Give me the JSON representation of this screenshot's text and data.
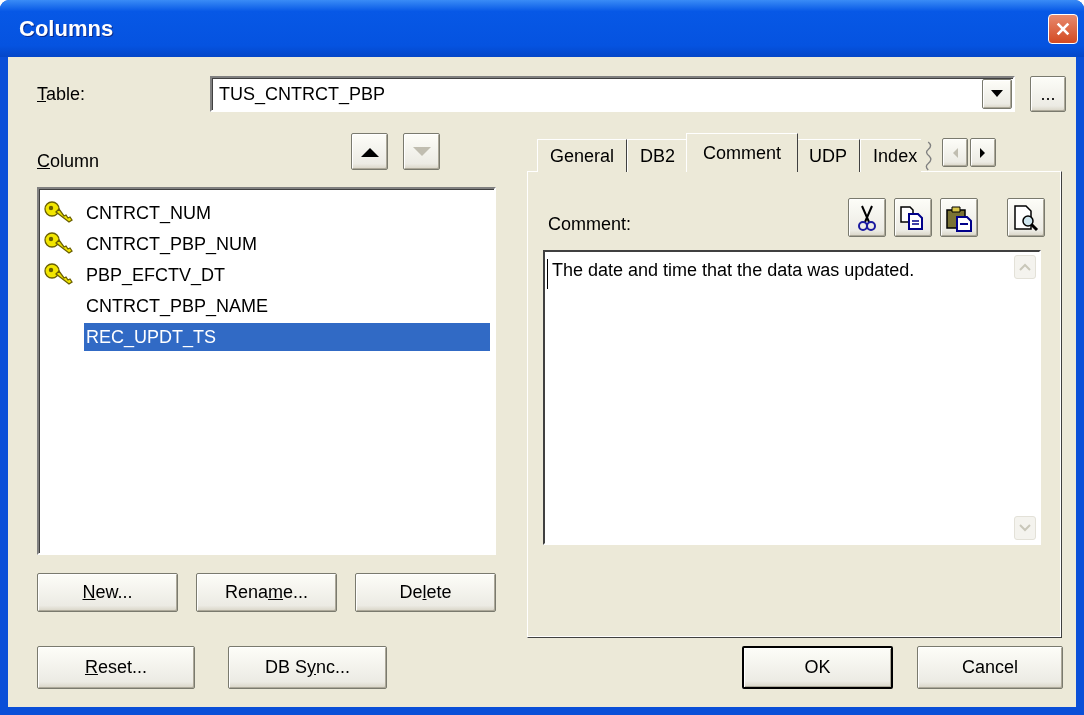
{
  "window": {
    "title": "Columns"
  },
  "table_field": {
    "label": {
      "key": "T",
      "post": "able:"
    },
    "value": "TUS_CNTRCT_PBP"
  },
  "browse_button": "...",
  "column_list": {
    "label": {
      "key": "C",
      "post": "olumn"
    },
    "move_up_disabled": false,
    "move_down_disabled": true,
    "items": [
      {
        "name": "CNTRCT_NUM",
        "kind": "key",
        "selected": false
      },
      {
        "name": "CNTRCT_PBP_NUM",
        "kind": "key",
        "selected": false
      },
      {
        "name": "PBP_EFCTV_DT",
        "kind": "key",
        "selected": false
      },
      {
        "name": "CNTRCT_PBP_NAME",
        "kind": "plain",
        "selected": false
      },
      {
        "name": "REC_UPDT_TS",
        "kind": "plain",
        "selected": true
      }
    ]
  },
  "list_buttons": [
    {
      "label": {
        "key": "N",
        "post": "ew..."
      }
    },
    {
      "label": {
        "pre": "Rena",
        "key": "m",
        "post": "e..."
      }
    },
    {
      "label": {
        "pre": "De",
        "key": "l",
        "post": "ete"
      }
    }
  ],
  "tabs": [
    {
      "label": "General",
      "selected": false
    },
    {
      "label": "DB2",
      "selected": false
    },
    {
      "label": "Comment",
      "selected": true
    },
    {
      "label": "UDP",
      "selected": false
    },
    {
      "label": "Index",
      "selected": false
    }
  ],
  "tab_scroll": {
    "left_disabled": true,
    "right_disabled": false
  },
  "comment": {
    "label": "Comment:",
    "value": "The date and time that the data was updated."
  },
  "footer_buttons": [
    {
      "label": {
        "key": "R",
        "post": "eset..."
      }
    },
    {
      "label": {
        "pre": "DB S",
        "key": "y",
        "post": "nc..."
      }
    }
  ],
  "dialog_buttons": [
    {
      "label": "OK",
      "default": true
    },
    {
      "label": "Cancel",
      "default": false
    }
  ]
}
